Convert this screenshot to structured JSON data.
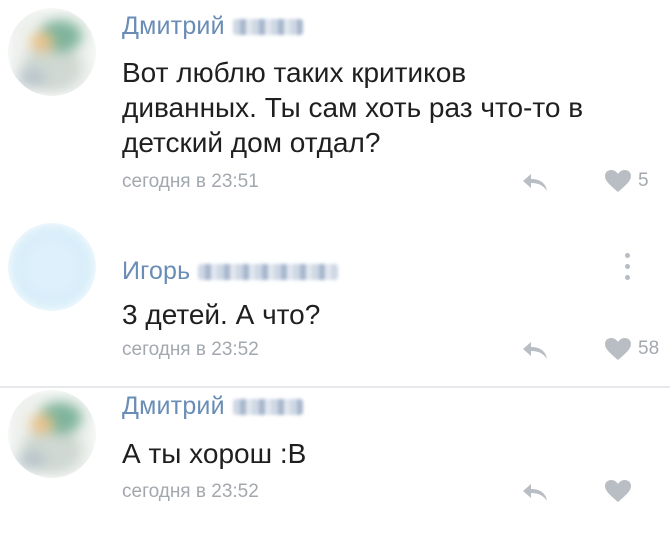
{
  "comments": [
    {
      "author": "Дмитрий",
      "text": "Вот люблю таких критиков\nдиванных. Ты сам хоть раз что-то в\nдетский дом отдал?",
      "time": "сегодня в 23:51",
      "likes": "5",
      "avatar": "blurred-bird-avatar"
    },
    {
      "author": "Игорь",
      "text": "3 детей. А что?",
      "time": "сегодня в 23:52",
      "likes": "58",
      "avatar": "blurred-light-blue-circle",
      "avatar_color": "#d6edf9"
    },
    {
      "author": "Дмитрий",
      "text": "А ты хорош :В",
      "time": "сегодня в 23:52",
      "likes": "",
      "avatar": "blurred-bird-avatar"
    }
  ],
  "icons": {
    "reply": "reply-arrow-icon",
    "like": "heart-icon",
    "more": "vertical-dots-icon"
  },
  "colors": {
    "author_name": "#6a8db5",
    "meta_text": "#a3a8ae",
    "body_text": "#1f1f1f",
    "divider": "#e6e8eb"
  }
}
